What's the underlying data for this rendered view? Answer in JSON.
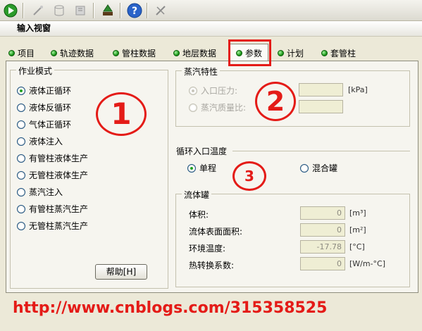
{
  "window": {
    "title": "输入视窗"
  },
  "toolbar": {
    "buttons": [
      "run-icon",
      "wand-icon",
      "cylinder-icon",
      "book-icon",
      "tree-icon",
      "help-icon",
      "tools-icon"
    ],
    "help_label": "?"
  },
  "tabs": [
    {
      "label": "项目",
      "active": false
    },
    {
      "label": "轨迹数据",
      "active": false
    },
    {
      "label": "管柱数据",
      "active": false
    },
    {
      "label": "地层数据",
      "active": false
    },
    {
      "label": "参数",
      "active": true
    },
    {
      "label": "计划",
      "active": false
    },
    {
      "label": "套管柱",
      "active": false
    }
  ],
  "work_mode": {
    "legend": "作业模式",
    "options": [
      {
        "label": "液体正循环",
        "checked": true
      },
      {
        "label": "液体反循环",
        "checked": false
      },
      {
        "label": "气体正循环",
        "checked": false
      },
      {
        "label": "液体注入",
        "checked": false
      },
      {
        "label": "有管柱液体生产",
        "checked": false
      },
      {
        "label": "无管柱液体生产",
        "checked": false
      },
      {
        "label": "蒸汽注入",
        "checked": false
      },
      {
        "label": "有管柱蒸汽生产",
        "checked": false
      },
      {
        "label": "无管柱蒸汽生产",
        "checked": false
      }
    ],
    "help_button": "帮助[H]"
  },
  "steam": {
    "legend": "蒸汽特性",
    "inlet_pressure_label": "入口压力:",
    "inlet_pressure_unit": "[kPa]",
    "steam_quality_label": "蒸汽质量比:"
  },
  "circ_temp": {
    "legend": "循环入口温度",
    "single_label": "单程",
    "mixed_label": "混合罐"
  },
  "tank": {
    "legend": "流体罐",
    "rows": [
      {
        "label": "体积:",
        "value": "0",
        "unit": "[m³]"
      },
      {
        "label": "流体表面面积:",
        "value": "0",
        "unit": "[m²]"
      },
      {
        "label": "环境温度:",
        "value": "-17.78",
        "unit": "[°C]"
      },
      {
        "label": "热转换系数:",
        "value": "0",
        "unit": "[W/m-°C]"
      }
    ]
  },
  "annotations": {
    "one": "1",
    "two": "2",
    "three": "3"
  },
  "watermark": "http://www.cnblogs.com/315358525",
  "colors": {
    "annotation": "#e41b17",
    "radio_dot": "#21a121"
  }
}
